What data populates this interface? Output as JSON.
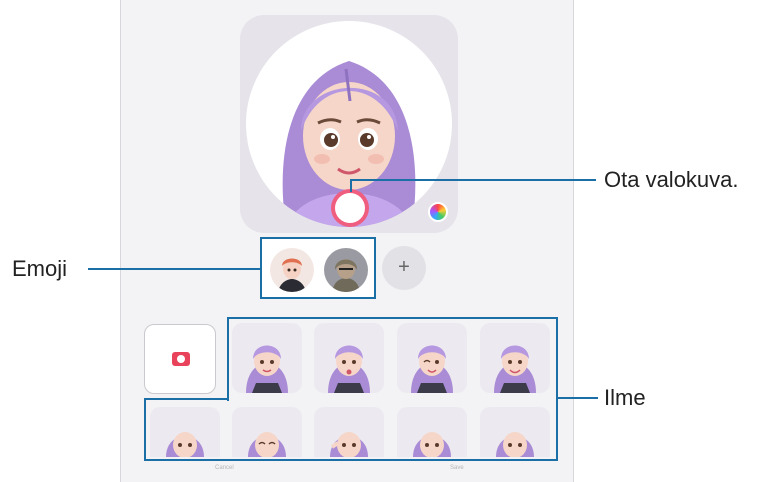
{
  "editor": {
    "section_label": "",
    "cancel_label": "Cancel",
    "save_label": "Save"
  },
  "emoji_list": {
    "add_symbol": "+"
  },
  "callouts": {
    "emoji": "Emoji",
    "take_photo": "Ota valokuva.",
    "expression": "Ilme"
  },
  "colors": {
    "highlight": "#1a6fa6",
    "shutter": "#ef5d7f",
    "hair": "#a98bd6",
    "camera_icon": "#e8435a"
  },
  "icons": {
    "shutter": "shutter-button-icon",
    "color_picker": "color-palette-icon",
    "camera": "camera-icon",
    "add": "plus-icon"
  }
}
